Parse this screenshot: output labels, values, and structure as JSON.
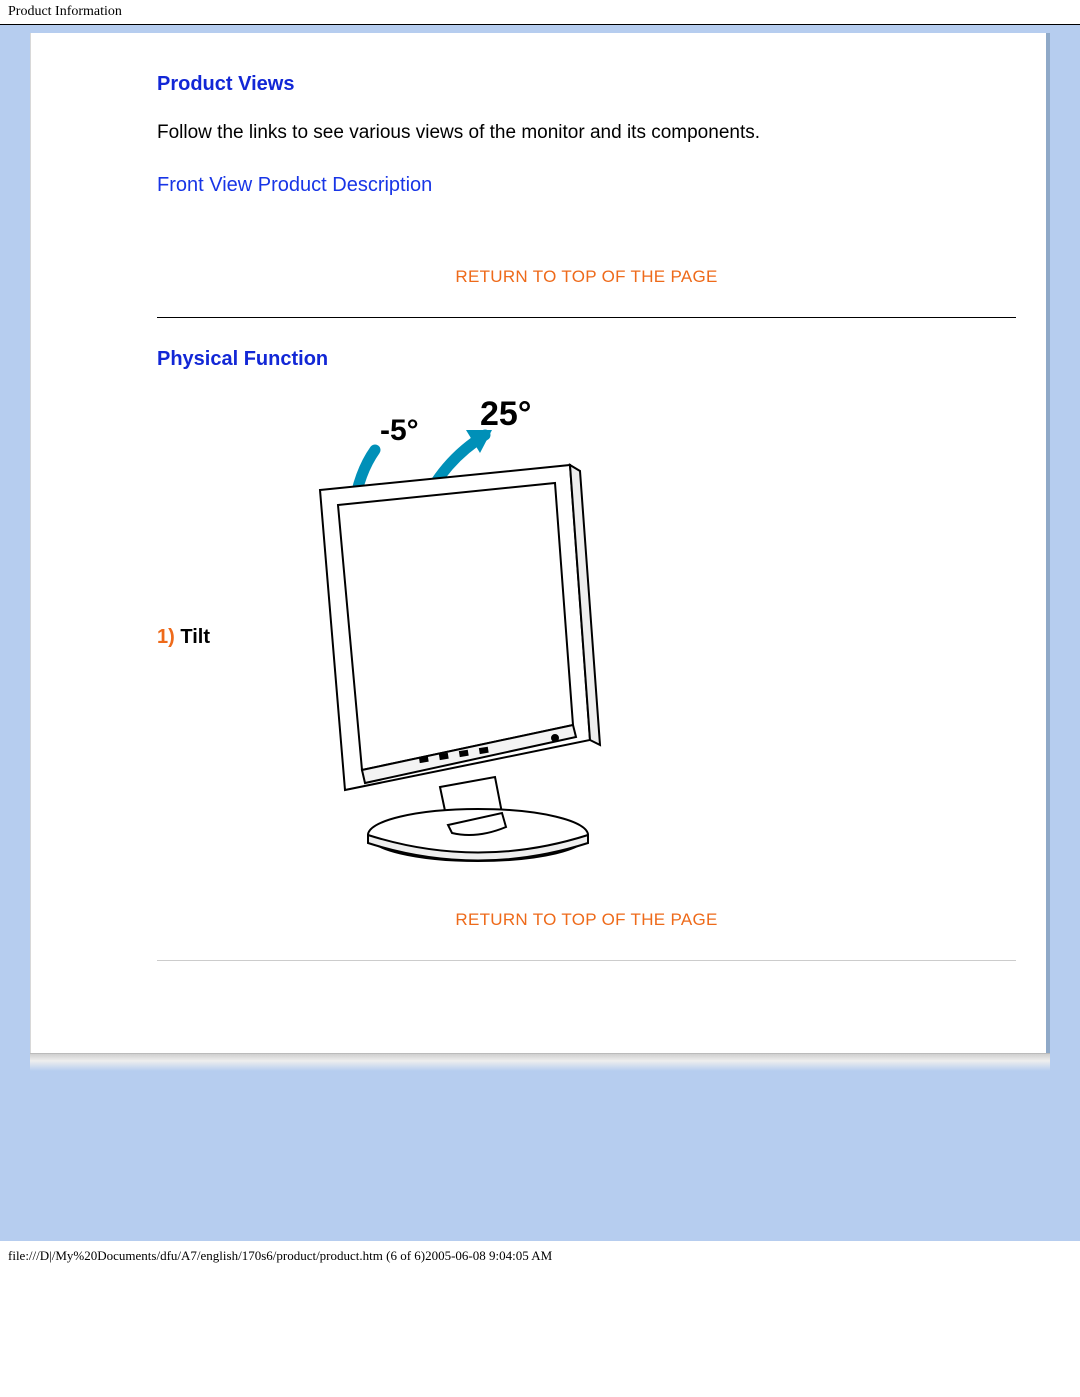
{
  "header": {
    "title": "Product Information"
  },
  "sections": {
    "productViews": {
      "heading": "Product Views",
      "intro": "Follow the links to see various views of the monitor and its components.",
      "frontViewLink": "Front View Product Description"
    },
    "returnTop": "RETURN TO TOP OF THE PAGE",
    "physicalFunction": {
      "heading": "Physical Function",
      "tilt": {
        "num": "1)",
        "label": "Tilt",
        "angleBack": "-5°",
        "angleForward": "25°"
      }
    }
  },
  "footer": {
    "path": "file:///D|/My%20Documents/dfu/A7/english/170s6/product/product.htm (6 of 6)2005-06-08 9:04:05 AM"
  }
}
